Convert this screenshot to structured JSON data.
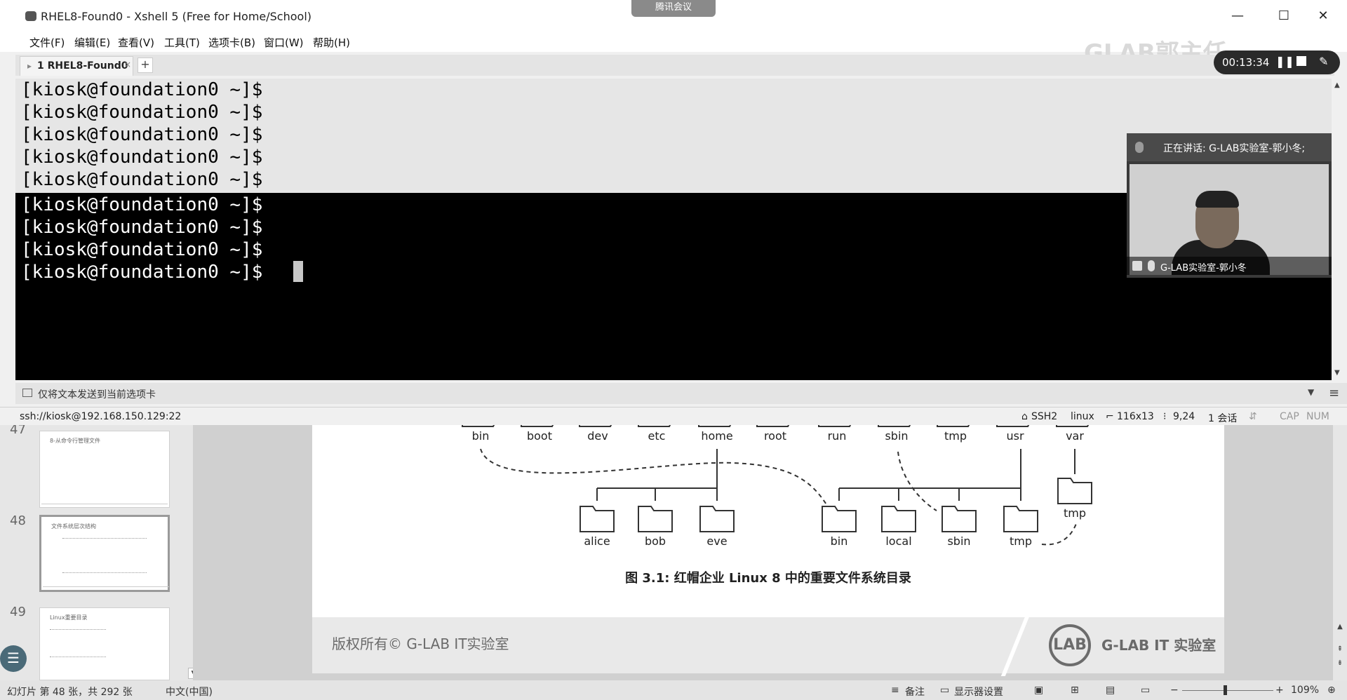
{
  "xshell": {
    "title": "RHEL8-Found0 - Xshell 5 (Free for Home/School)",
    "menu": [
      "文件(F)",
      "编辑(E)",
      "查看(V)",
      "工具(T)",
      "选项卡(B)",
      "窗口(W)",
      "帮助(H)"
    ],
    "tab_label": "1 RHEL8-Found0",
    "tab_close": "×",
    "tab_add": "+",
    "prompt_lines": [
      "[kiosk@foundation0 ~]$",
      "[kiosk@foundation0 ~]$",
      "[kiosk@foundation0 ~]$",
      "[kiosk@foundation0 ~]$",
      "[kiosk@foundation0 ~]$",
      "[kiosk@foundation0 ~]$",
      "[kiosk@foundation0 ~]$",
      "[kiosk@foundation0 ~]$",
      "[kiosk@foundation0 ~]$"
    ],
    "send_bar_text": "仅将文本发送到当前选项卡",
    "status": {
      "connection": "ssh://kiosk@192.168.150.129:22",
      "protocol": "SSH2",
      "term": "linux",
      "size": "116x13",
      "cursor_pos": "9,24",
      "sessions": "1 会话",
      "cap": "CAP",
      "num": "NUM"
    }
  },
  "meeting": {
    "top_tab": "腾讯会议",
    "watermark": "GLAB郭主任",
    "rec_time": "00:13:34",
    "speaking_title": "正在讲话: G-LAB实验室-郭小冬;",
    "speaker_name": "G-LAB实验室-郭小冬"
  },
  "ppt": {
    "thumbs": [
      {
        "num": "47",
        "title": "8-从命令行管理文件"
      },
      {
        "num": "48",
        "title": "文件系统层次结构"
      },
      {
        "num": "49",
        "title": "Linux重要目录"
      }
    ],
    "diagram_top_dirs": [
      "bin",
      "boot",
      "dev",
      "etc",
      "home",
      "root",
      "run",
      "sbin",
      "tmp",
      "usr",
      "var"
    ],
    "home_children": [
      "alice",
      "bob",
      "eve"
    ],
    "usr_children": [
      "bin",
      "local",
      "sbin",
      "tmp"
    ],
    "var_child": "tmp",
    "caption": "图 3.1: 红帽企业 Linux 8 中的重要文件系统目录",
    "footer_copyright": "版权所有© G-LAB IT实验室",
    "footer_logo": "LAB",
    "footer_brand": "G-LAB IT 实验室",
    "statusbar": {
      "slide_info": "幻灯片 第 48 张，共 292 张",
      "language": "中文(中国)",
      "notes": "备注",
      "display": "显示器设置",
      "zoom": "109%"
    }
  }
}
